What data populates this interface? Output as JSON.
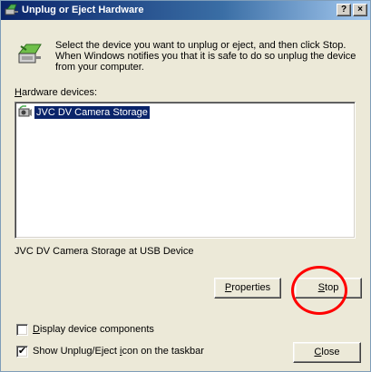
{
  "window": {
    "title": "Unplug or Eject Hardware",
    "help_glyph": "?",
    "close_glyph": "×"
  },
  "instructions": "Select the device you want to unplug or eject, and then click Stop. When Windows notifies you that it is safe to do so unplug the device from your computer.",
  "hardware_label_prefix": "H",
  "hardware_label_rest": "ardware devices:",
  "devices": [
    {
      "label": "JVC DV Camera Storage",
      "selected": true
    }
  ],
  "selected_device_description": "JVC DV Camera Storage at USB Device",
  "buttons": {
    "properties_accel": "P",
    "properties_rest": "roperties",
    "stop_accel": "S",
    "stop_rest": "top",
    "close_accel": "C",
    "close_rest": "lose"
  },
  "options": {
    "display_components_accel": "D",
    "display_components_rest": "isplay device components",
    "display_components_checked": false,
    "show_icon_prefix": "Show Unplug/Eject ",
    "show_icon_accel": "i",
    "show_icon_rest": "con on the taskbar",
    "show_icon_checked": true,
    "check_glyph": "✔"
  },
  "colors": {
    "titlebar_start": "#0a246a",
    "selection": "#0a246a",
    "highlight": "#ff0000",
    "dialog_bg": "#ECE9D8"
  }
}
